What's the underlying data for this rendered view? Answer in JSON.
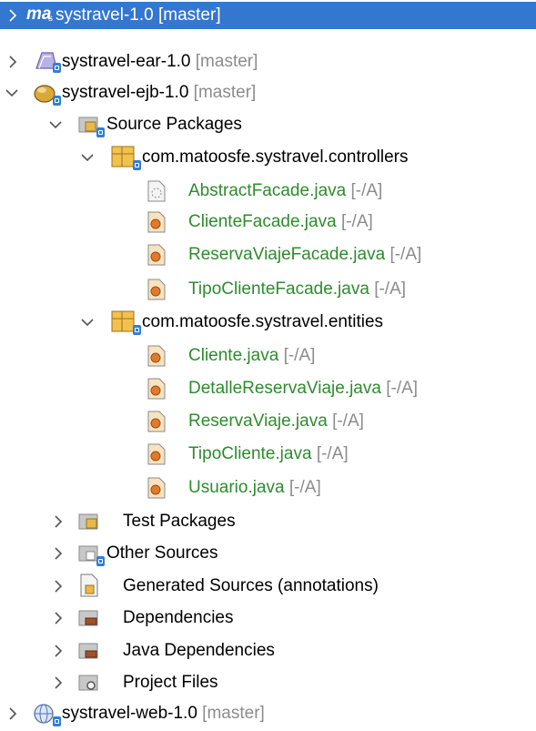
{
  "tree": {
    "projects": [
      {
        "name": "systravel-1.0",
        "branch": "[master]",
        "icon": "maven-project-icon",
        "prefix": "ma"
      },
      {
        "name": "systravel-ear-1.0",
        "branch": "[master]",
        "icon": "ear-project-icon"
      },
      {
        "name": "systravel-ejb-1.0",
        "branch": "[master]",
        "icon": "ejb-project-icon"
      },
      {
        "name": "systravel-web-1.0",
        "branch": "[master]",
        "icon": "web-project-icon"
      }
    ],
    "source_packages": "Source Packages",
    "packages": [
      {
        "name": "com.matoosfe.systravel.controllers",
        "files": [
          {
            "name": "AbstractFacade.java",
            "status": "[-/A]"
          },
          {
            "name": "ClienteFacade.java",
            "status": "[-/A]"
          },
          {
            "name": "ReservaViajeFacade.java",
            "status": "[-/A]"
          },
          {
            "name": "TipoClienteFacade.java",
            "status": "[-/A]"
          }
        ]
      },
      {
        "name": "com.matoosfe.systravel.entities",
        "files": [
          {
            "name": "Cliente.java",
            "status": "[-/A]"
          },
          {
            "name": "DetalleReservaViaje.java",
            "status": "[-/A]"
          },
          {
            "name": "ReservaViaje.java",
            "status": "[-/A]"
          },
          {
            "name": "TipoCliente.java",
            "status": "[-/A]"
          },
          {
            "name": "Usuario.java",
            "status": "[-/A]"
          }
        ]
      }
    ],
    "nodes": [
      {
        "name": "Test Packages",
        "icon": "test-packages-icon"
      },
      {
        "name": "Other Sources",
        "icon": "other-sources-icon"
      },
      {
        "name": "Generated Sources (annotations)",
        "icon": "generated-sources-icon"
      },
      {
        "name": "Dependencies",
        "icon": "dependencies-icon"
      },
      {
        "name": "Java Dependencies",
        "icon": "java-dependencies-icon"
      },
      {
        "name": "Project Files",
        "icon": "project-files-icon"
      }
    ]
  },
  "colors": {
    "selection": "#3477d1",
    "added_file": "#2e8b2e",
    "status_tag": "#8c8c8c",
    "vcs_badge": "#2f7fd8"
  }
}
